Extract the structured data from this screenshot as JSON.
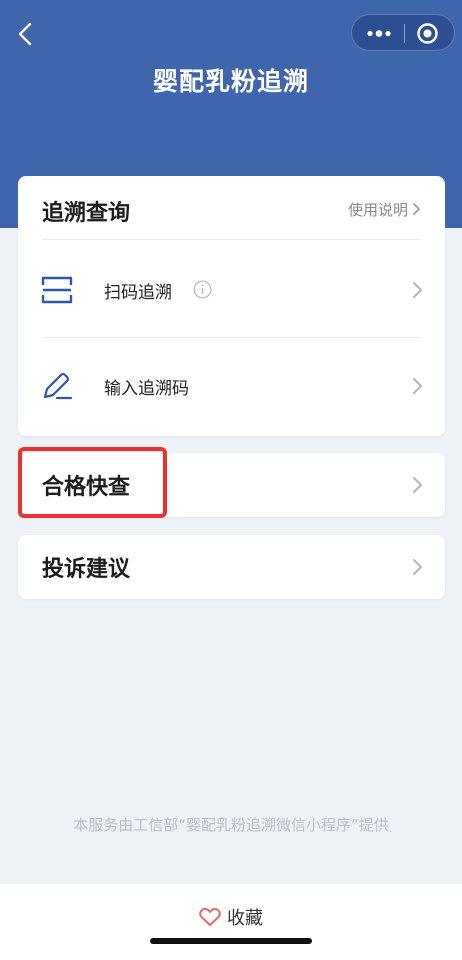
{
  "nav": {
    "title": "婴配乳粉追溯",
    "back_icon": "chevron-left-icon",
    "more_icon": "more-dots-icon",
    "close_icon": "target-circle-icon"
  },
  "trace_card": {
    "title": "追溯查询",
    "help_label": "使用说明",
    "items": [
      {
        "label": "扫码追溯",
        "icon": "scan-icon"
      },
      {
        "label": "输入追溯码",
        "icon": "pen-icon"
      }
    ]
  },
  "quick_check": {
    "label": "合格快查"
  },
  "complaint": {
    "label": "投诉建议"
  },
  "footer": {
    "note": "本服务由工信部“婴配乳粉追溯微信小程序”提供"
  },
  "bottom_bar": {
    "favorite_label": "收藏"
  },
  "colors": {
    "header": "#3f66ad",
    "accent": "#e8322f",
    "icon_blue": "#2e57a6"
  }
}
